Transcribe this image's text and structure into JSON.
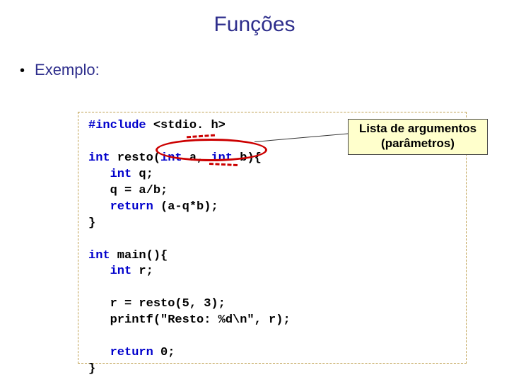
{
  "title": "Funções",
  "bullet": "Exemplo:",
  "callout": {
    "line1": "Lista de argumentos",
    "line2": "(parâmetros)"
  },
  "code": {
    "l1a": "#include",
    "l1b": " <stdio. h>",
    "l3a": "int",
    "l3b": " resto(",
    "l3c": "int",
    "l3d": " a, ",
    "l3e": "int",
    "l3f": " b){",
    "l4a": "   int",
    "l4b": " q;",
    "l5": "   q = a/b;",
    "l6a": "   return",
    "l6b": " (a-q*b);",
    "l7": "}",
    "l9a": "int",
    "l9b": " main(){",
    "l10a": "   int",
    "l10b": " r;",
    "l12": "   r = resto(5, 3);",
    "l13": "   printf(\"Resto: %d\\n\", r);",
    "l15a": "   return",
    "l15b": " 0;",
    "l16": "}"
  }
}
